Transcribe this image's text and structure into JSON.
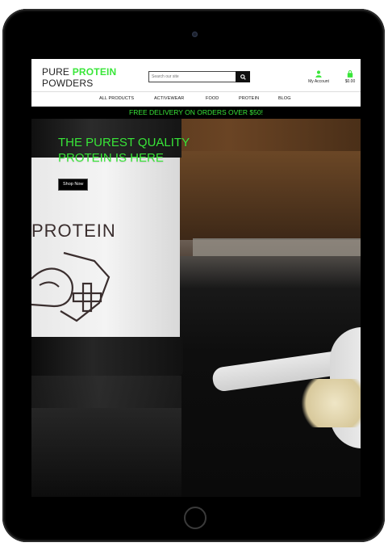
{
  "header": {
    "logo_line1_a": "PURE ",
    "logo_line1_b": "PROTEIN",
    "logo_line2": "POWDERS",
    "search_placeholder": "Search our site",
    "account_label": "My Account",
    "cart_total": "$0.00"
  },
  "nav": {
    "items": [
      "ALL PRODUCTS",
      "ACTIVEWEAR",
      "FOOD",
      "PROTEIN",
      "BLOG"
    ]
  },
  "promo": {
    "text": "FREE DELIVERY ON ORDERS OVER $50!"
  },
  "hero": {
    "title_line1": "THE PUREST QUALITY",
    "title_line2": "PROTEIN IS HERE",
    "cta_label": "Shop Now",
    "jar_label_word": "PROTEIN"
  },
  "icons": {
    "search": "search-icon",
    "user": "user-icon",
    "cart": "shopping-bag-icon",
    "scroll_top": "arrow-up-icon"
  },
  "colors": {
    "accent": "#39e639",
    "dark": "#000000"
  }
}
